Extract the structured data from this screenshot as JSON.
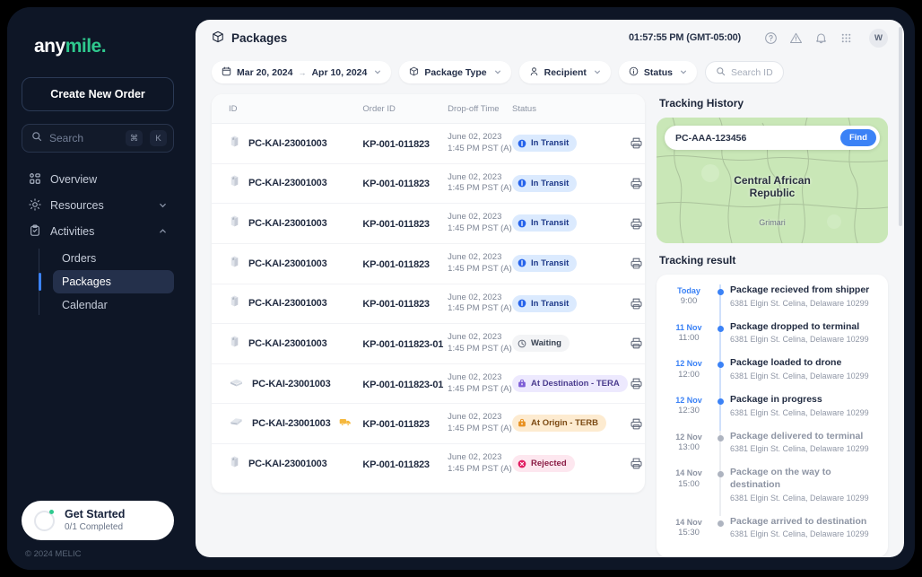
{
  "brand": {
    "name_part1": "any",
    "name_part2": "mile",
    "dot": "."
  },
  "sidebar": {
    "cta_label": "Create New Order",
    "search_placeholder": "Search",
    "kbd_cmd": "⌘",
    "kbd_key": "K",
    "nav": [
      {
        "label": "Overview",
        "icon": "grid-icon",
        "expandable": false
      },
      {
        "label": "Resources",
        "icon": "sun-icon",
        "expandable": true,
        "chev": "⌄"
      },
      {
        "label": "Activities",
        "icon": "clipboard-check-icon",
        "expandable": true,
        "chev": "⌃"
      }
    ],
    "subnav": [
      {
        "label": "Orders",
        "active": false
      },
      {
        "label": "Packages",
        "active": true
      },
      {
        "label": "Calendar",
        "active": false
      }
    ],
    "get_started": {
      "title": "Get Started",
      "subtitle": "0/1 Completed"
    },
    "copyright": "© 2024 MELIC"
  },
  "header": {
    "title": "Packages",
    "clock": "01:57:55 PM (GMT-05:00)",
    "icons": [
      "help-circle-icon",
      "warning-triangle-icon",
      "bell-icon",
      "apps-grid-icon"
    ],
    "avatar_initial": "W"
  },
  "filters": {
    "date_from": "Mar 20, 2024",
    "date_arrow": "→",
    "date_to": "Apr 10, 2024",
    "package_type": "Package Type",
    "recipient": "Recipient",
    "status": "Status",
    "search_placeholder": "Search ID"
  },
  "table": {
    "columns": [
      "ID",
      "Order ID",
      "Drop-off Time",
      "Status",
      ""
    ],
    "rows": [
      {
        "pkg_icon": "box-icon",
        "id": "PC-KAI-23001003",
        "truck": false,
        "order_id": "KP-001-011823",
        "date": "June 02, 2023",
        "time": "1:45 PM PST (A)",
        "status": "In Transit",
        "status_type": "in-transit",
        "print": "printer-icon"
      },
      {
        "pkg_icon": "box-icon",
        "id": "PC-KAI-23001003",
        "truck": false,
        "order_id": "KP-001-011823",
        "date": "June 02, 2023",
        "time": "1:45 PM PST (A)",
        "status": "In Transit",
        "status_type": "in-transit",
        "print": "printer-icon"
      },
      {
        "pkg_icon": "box-icon",
        "id": "PC-KAI-23001003",
        "truck": false,
        "order_id": "KP-001-011823",
        "date": "June 02, 2023",
        "time": "1:45 PM PST (A)",
        "status": "In Transit",
        "status_type": "in-transit",
        "print": "printer-icon"
      },
      {
        "pkg_icon": "box-icon",
        "id": "PC-KAI-23001003",
        "truck": false,
        "order_id": "KP-001-011823",
        "date": "June 02, 2023",
        "time": "1:45 PM PST (A)",
        "status": "In Transit",
        "status_type": "in-transit",
        "print": "printer-icon"
      },
      {
        "pkg_icon": "box-icon",
        "id": "PC-KAI-23001003",
        "truck": false,
        "order_id": "KP-001-011823",
        "date": "June 02, 2023",
        "time": "1:45 PM PST (A)",
        "status": "In Transit",
        "status_type": "in-transit",
        "print": "printer-icon"
      },
      {
        "pkg_icon": "box-icon",
        "id": "PC-KAI-23001003",
        "truck": false,
        "order_id": "KP-001-011823-01",
        "date": "June 02, 2023",
        "time": "1:45 PM PST (A)",
        "status": "Waiting",
        "status_type": "waiting",
        "print": "printer-icon"
      },
      {
        "pkg_icon": "flat-envelope-icon",
        "id": "PC-KAI-23001003",
        "truck": false,
        "order_id": "KP-001-011823-01",
        "date": "June 02, 2023",
        "time": "1:45 PM PST (A)",
        "status": "At Destination - TERA",
        "status_type": "at-destination",
        "print": "printer-icon"
      },
      {
        "pkg_icon": "tilted-flat-icon",
        "id": "PC-KAI-23001003",
        "truck": true,
        "order_id": "KP-001-011823",
        "date": "June 02, 2023",
        "time": "1:45 PM PST (A)",
        "status": "At Origin - TERB",
        "status_type": "at-origin",
        "print": "printer-icon"
      },
      {
        "pkg_icon": "box-icon",
        "id": "PC-KAI-23001003",
        "truck": false,
        "order_id": "KP-001-011823",
        "date": "June 02, 2023",
        "time": "1:45 PM PST (A)",
        "status": "Rejected",
        "status_type": "rejected",
        "print": "printer-icon"
      }
    ]
  },
  "tracking": {
    "history_heading": "Tracking History",
    "map_value": "PC-AAA-123456",
    "find_label": "Find",
    "map_country": "Central African\nRepublic",
    "map_country_line1": "Central African",
    "map_country_line2": "Republic",
    "map_city": "Grimari",
    "result_heading": "Tracking result",
    "events": [
      {
        "date": "Today",
        "time": "9:00",
        "title": "Package recieved from shipper",
        "address": "6381 Elgin St. Celina, Delaware 10299",
        "state": "active"
      },
      {
        "date": "11 Nov",
        "time": "11:00",
        "title": "Package dropped to terminal",
        "address": "6381 Elgin St. Celina, Delaware 10299",
        "state": "active"
      },
      {
        "date": "12 Nov",
        "time": "12:00",
        "title": "Package loaded to drone",
        "address": "6381 Elgin St. Celina, Delaware 10299",
        "state": "active"
      },
      {
        "date": "12 Nov",
        "time": "12:30",
        "title": "Package in progress",
        "address": "6381 Elgin St. Celina, Delaware 10299",
        "state": "active"
      },
      {
        "date": "12 Nov",
        "time": "13:00",
        "title": "Package delivered to terminal",
        "address": "6381 Elgin St. Celina, Delaware 10299",
        "state": "past"
      },
      {
        "date": "14 Nov",
        "time": "15:00",
        "title": "Package on the way to destination",
        "address": "6381 Elgin St. Celina, Delaware 10299",
        "state": "past"
      },
      {
        "date": "14 Nov",
        "time": "15:30",
        "title": "Package arrived to destination",
        "address": "6381 Elgin St. Celina, Delaware 10299",
        "state": "past"
      }
    ]
  },
  "colors": {
    "sidebar_bg": "#0e1626",
    "accent_blue": "#3b82f6",
    "brand_green": "#2fc98e",
    "status_in_transit_bg": "#dbeafe",
    "status_in_transit_fg": "#1e3a8a",
    "status_waiting_bg": "#f3f4f6",
    "status_waiting_fg": "#374151",
    "status_at_destination_bg": "#ede9fe",
    "status_at_destination_fg": "#4c3d8f",
    "status_at_origin_bg": "#fdebd0",
    "status_at_origin_fg": "#7c4a13",
    "status_rejected_bg": "#fde7ef",
    "status_rejected_fg": "#8a1c44"
  }
}
